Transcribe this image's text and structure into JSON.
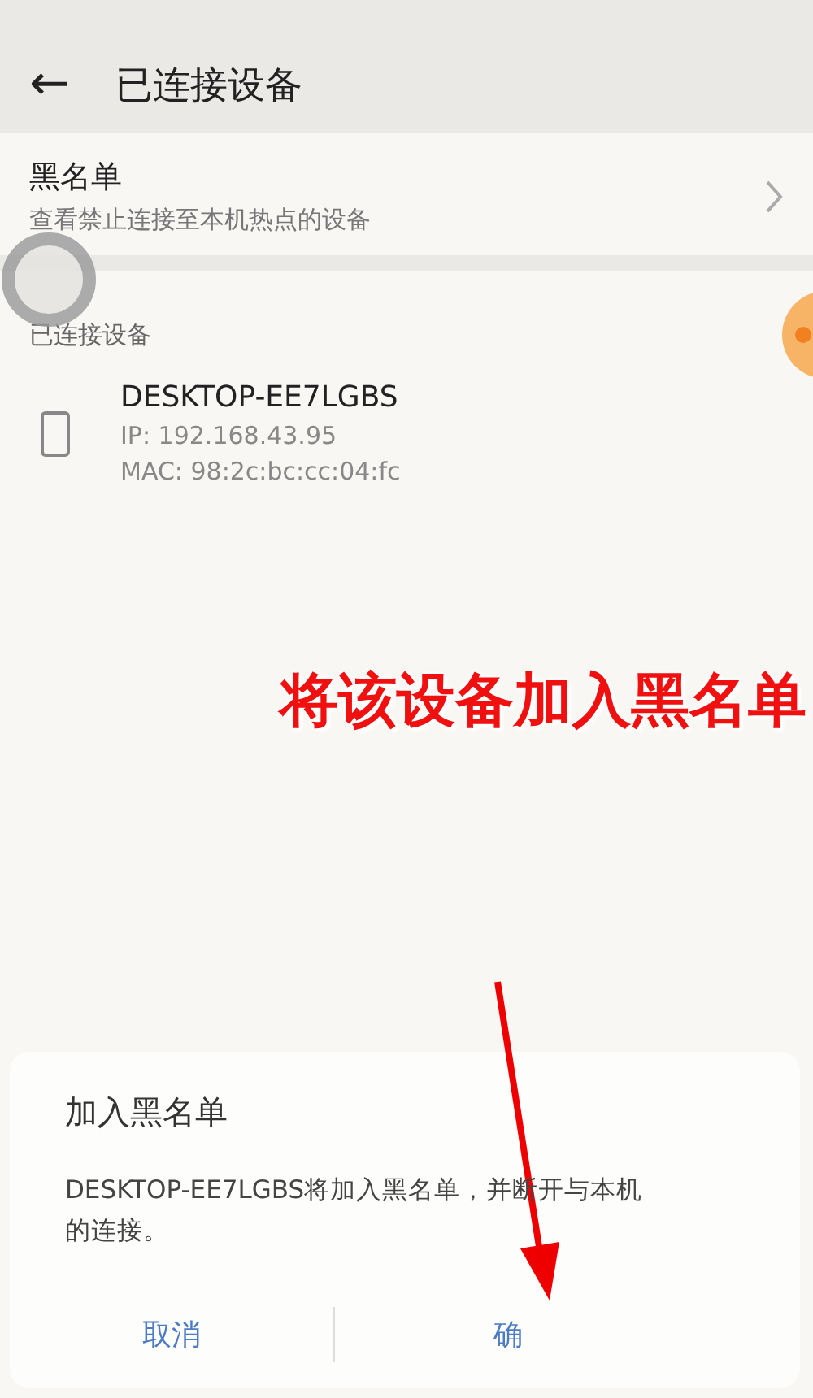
{
  "app_bar": {
    "back": "←",
    "title": "已连接设备"
  },
  "blacklist": {
    "title": "黑名单",
    "subtitle": "查看禁止连接至本机热点的设备"
  },
  "section": {
    "label": "已连接设备"
  },
  "devices": [
    {
      "name": "DESKTOP-EE7LGBS",
      "ip": "IP: 192.168.43.95",
      "mac": "MAC: 98:2c:bc:cc:04:fc"
    }
  ],
  "annotation": {
    "text": "将该设备加入黑名单"
  },
  "dialog": {
    "title": "加入黑名单",
    "message": "DESKTOP-EE7LGBS将加入黑名单，并断开与本机的连接。",
    "buttons": [
      {
        "label": "取消",
        "kind": "cancel"
      },
      {
        "label": "确",
        "kind": "confirm"
      }
    ]
  }
}
